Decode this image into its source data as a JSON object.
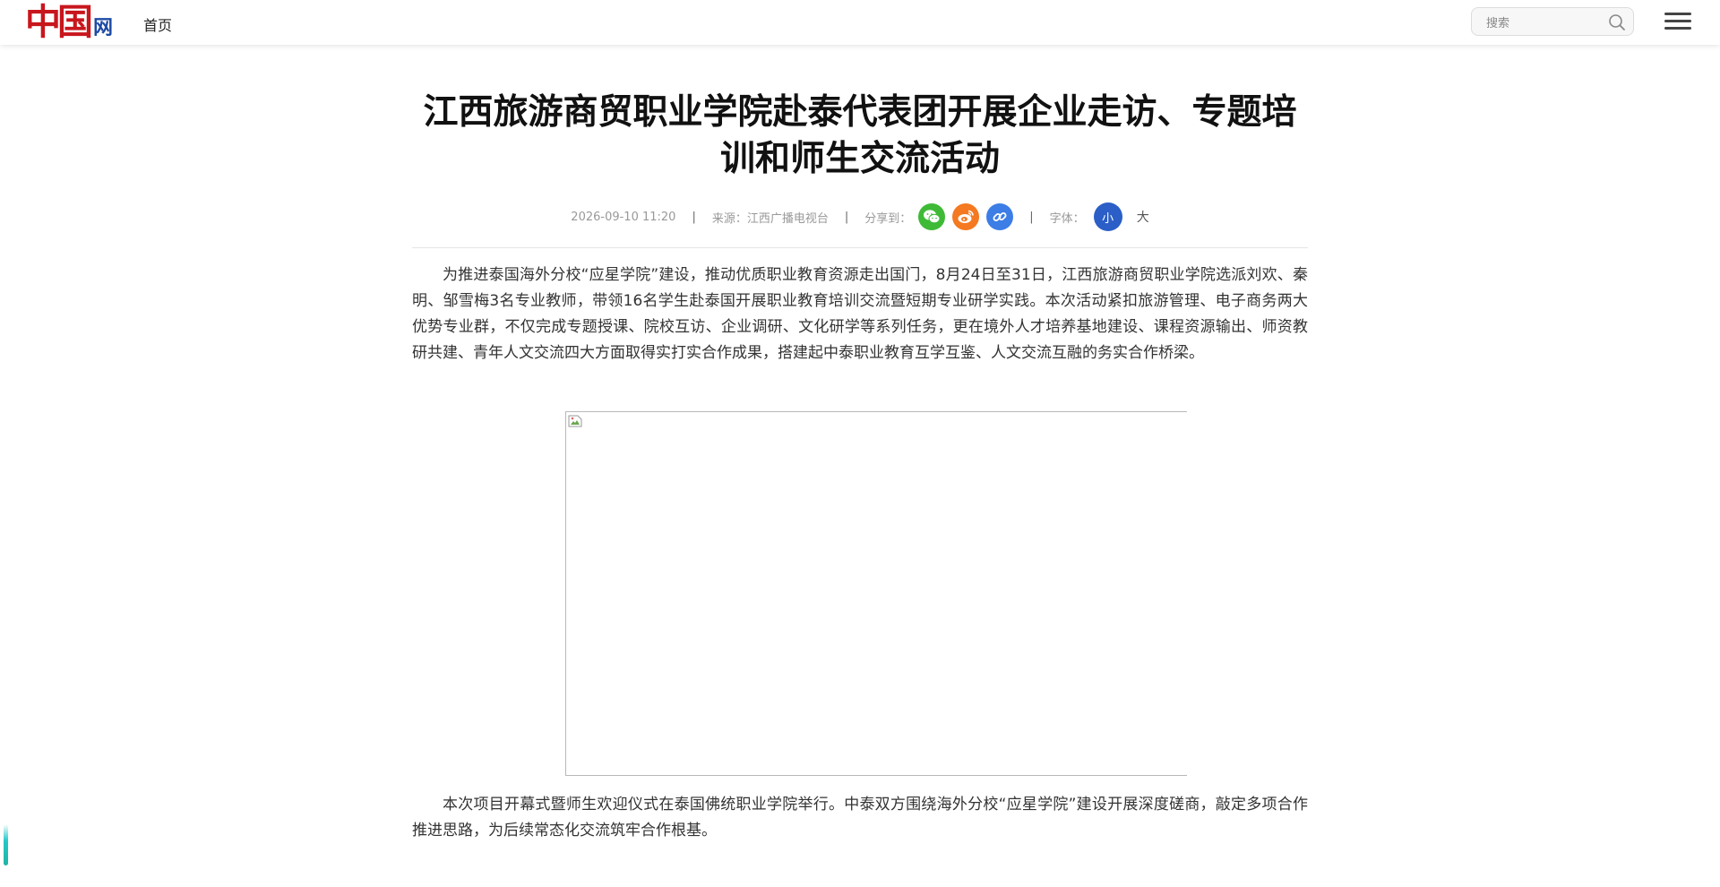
{
  "header": {
    "logo": {
      "main": "中国",
      "suffix": "网"
    },
    "nav_home": "首页",
    "search": {
      "placeholder": "搜索",
      "icon": "search-icon"
    },
    "menu_icon": "hamburger-icon"
  },
  "article": {
    "title": "江西旅游商贸职业学院赴泰代表团开展企业走访、专题培训和师生交流活动",
    "meta": {
      "datetime": "2026-09-10 11:20",
      "separator": "|",
      "source_label": "来源：",
      "source": "江西广播电视台",
      "share_label": "分享到：",
      "share_icons": [
        "wechat-icon",
        "weibo-icon",
        "link-icon"
      ],
      "font_label": "字体：",
      "font_small": "小",
      "font_large": "大"
    },
    "paragraphs": [
      "为推进泰国海外分校“应星学院”建设，推动优质职业教育资源走出国门，8月24日至31日，江西旅游商贸职业学院选派刘欢、秦明、邹雪梅3名专业教师，带领16名学生赴泰国开展职业教育培训交流暨短期专业研学实践。本次活动紧扣旅游管理、电子商务两大优势专业群，不仅完成专题授课、院校互访、企业调研、文化研学等系列任务，更在境外人才培养基地建设、课程资源输出、师资教研共建、青年人文交流四大方面取得实打实合作成果，搭建起中泰职业教育互学互鉴、人文交流互融的务实合作桥梁。",
      "本次项目开幕式暨师生欢迎仪式在泰国佛统职业学院举行。中泰双方围绕海外分校“应星学院”建设开展深度磋商，敲定多项合作推进思路，为后续常态化交流筑牢合作根基。"
    ],
    "image_icon": "broken-image-icon"
  },
  "colors": {
    "brand_red": "#c8161d",
    "brand_blue": "#1e4aa3",
    "wechat": "#3fba37",
    "weibo": "#f47920",
    "link": "#3d7de6",
    "font_active": "#2b5fc7"
  }
}
